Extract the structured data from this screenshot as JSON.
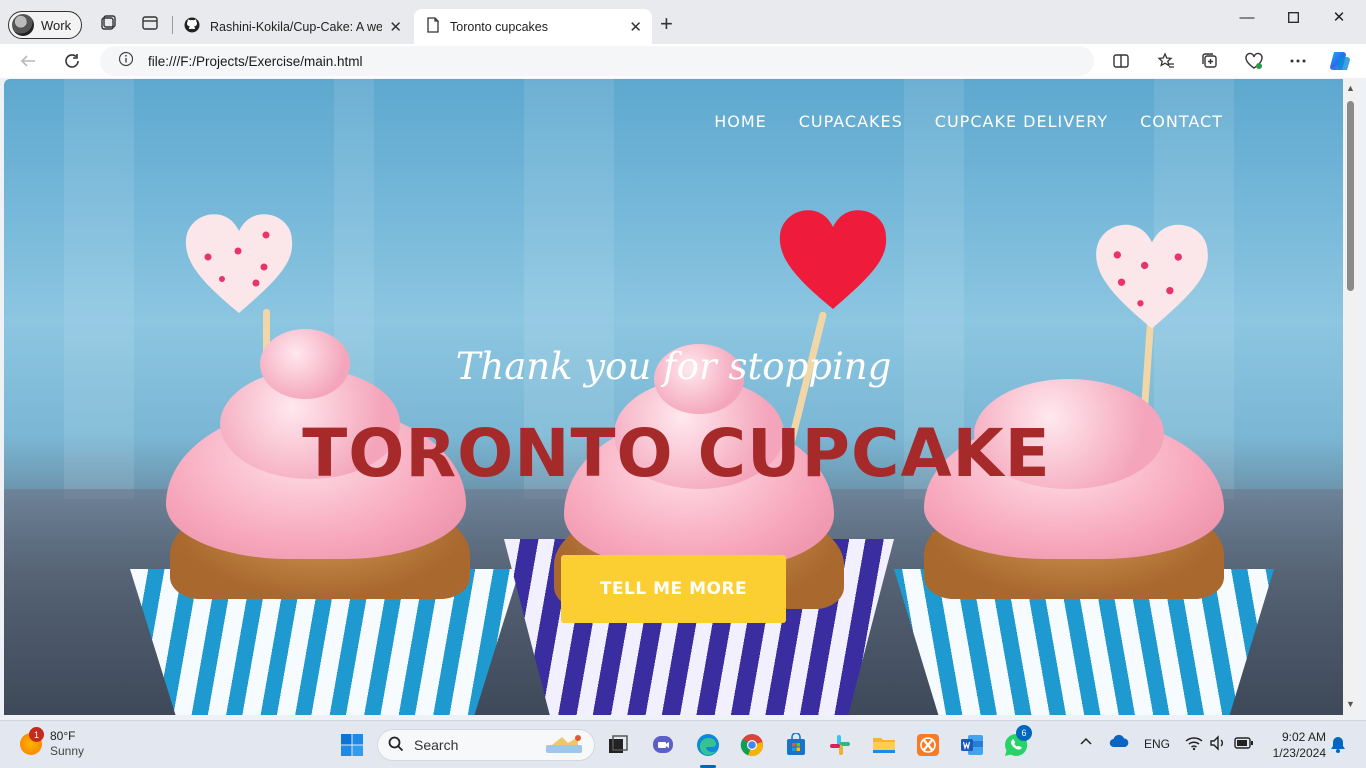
{
  "browser": {
    "profile_label": "Work",
    "tabs": [
      {
        "title": "Rashini-Kokila/Cup-Cake: A web"
      },
      {
        "title": "Toronto cupcakes"
      }
    ],
    "url": "file:///F:/Projects/Exercise/main.html"
  },
  "page": {
    "nav": [
      "HOME",
      "CUPACAKES",
      "CUPCAKE DELIVERY",
      "CONTACT"
    ],
    "subtitle": "Thank you for stopping",
    "title": "TORONTO CUPCAKE",
    "cta_label": "TELL ME MORE",
    "colors": {
      "title": "#a72a2a",
      "cta": "#fbcf32"
    }
  },
  "taskbar": {
    "weather_temp": "80°F",
    "weather_desc": "Sunny",
    "weather_badge": "1",
    "search_placeholder": "Search",
    "whatsapp_badge": "6",
    "language": "ENG",
    "time": "9:02 AM",
    "date": "1/23/2024"
  }
}
